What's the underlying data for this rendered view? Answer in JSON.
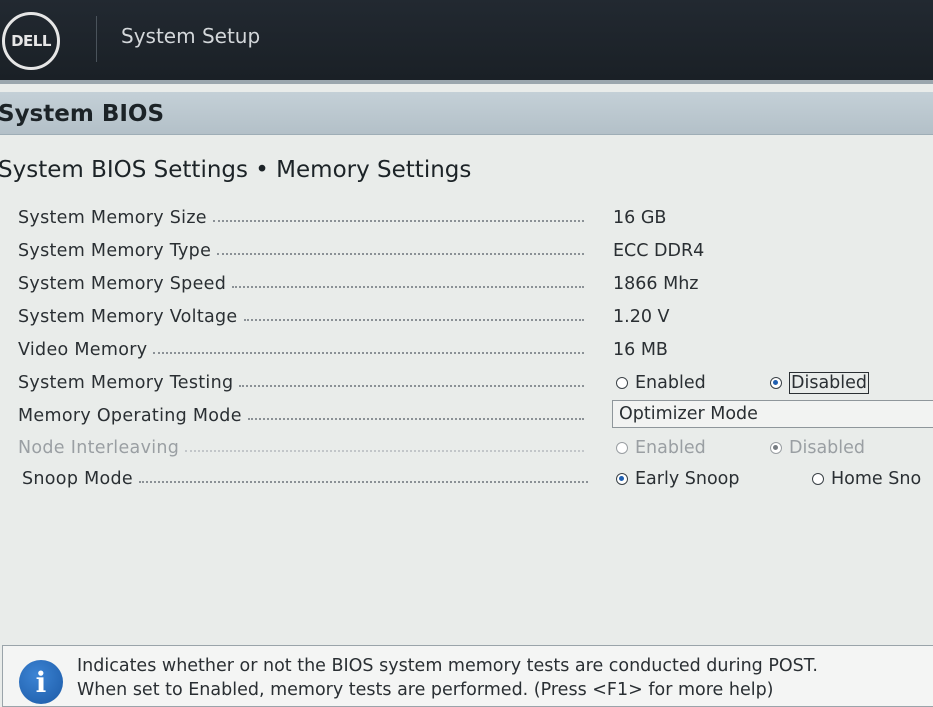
{
  "header": {
    "logo_text": "DELL",
    "app_title": "System Setup"
  },
  "section": {
    "title": "System BIOS"
  },
  "page": {
    "breadcrumb": "System BIOS Settings • Memory Settings"
  },
  "settings": [
    {
      "label": "System Memory Size",
      "value": "16 GB"
    },
    {
      "label": "System Memory Type",
      "value": "ECC DDR4"
    },
    {
      "label": "System Memory Speed",
      "value": "1866 Mhz"
    },
    {
      "label": "System Memory Voltage",
      "value": "1.20 V"
    },
    {
      "label": "Video Memory",
      "value": "16 MB"
    },
    {
      "label": "System Memory Testing",
      "options": [
        "Enabled",
        "Disabled"
      ],
      "selected": "Disabled"
    },
    {
      "label": "Memory Operating Mode",
      "value": "Optimizer Mode"
    },
    {
      "label": "Node Interleaving",
      "options": [
        "Enabled",
        "Disabled"
      ],
      "selected": "Disabled",
      "disabled": true
    },
    {
      "label": "Snoop Mode",
      "options": [
        "Early Snoop",
        "Home Sno"
      ],
      "selected": "Early Snoop"
    }
  ],
  "help": {
    "icon": "info-icon",
    "line1": "Indicates whether or not the BIOS system memory tests are conducted during POST.",
    "line2": "When set to Enabled, memory tests are performed. (Press <F1> for more help)"
  }
}
